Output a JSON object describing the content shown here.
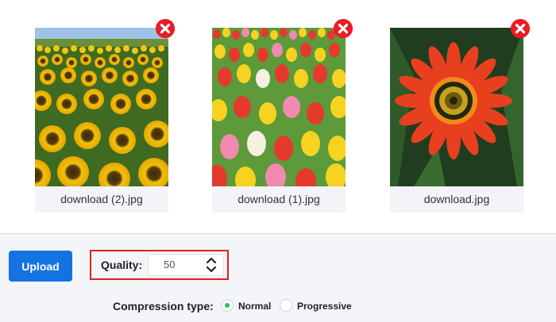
{
  "images": [
    {
      "filename": "download (2).jpg",
      "picture": "sunflower field"
    },
    {
      "filename": "download (1).jpg",
      "picture": "tulip field"
    },
    {
      "filename": "download.jpg",
      "picture": "orange gazania flower"
    }
  ],
  "remove_icon": "close-x-icon",
  "toolbar": {
    "upload_label": "Upload",
    "quality_label": "Quality:",
    "quality_value": "50",
    "compression_label": "Compression type:",
    "options": [
      {
        "label": "Normal",
        "selected": true
      },
      {
        "label": "Progressive",
        "selected": false
      }
    ]
  },
  "colors": {
    "accent": "#1472e3",
    "remove": "#ea1c24",
    "highlight_border": "#e01f1f",
    "selected_radio": "#22c55e"
  }
}
